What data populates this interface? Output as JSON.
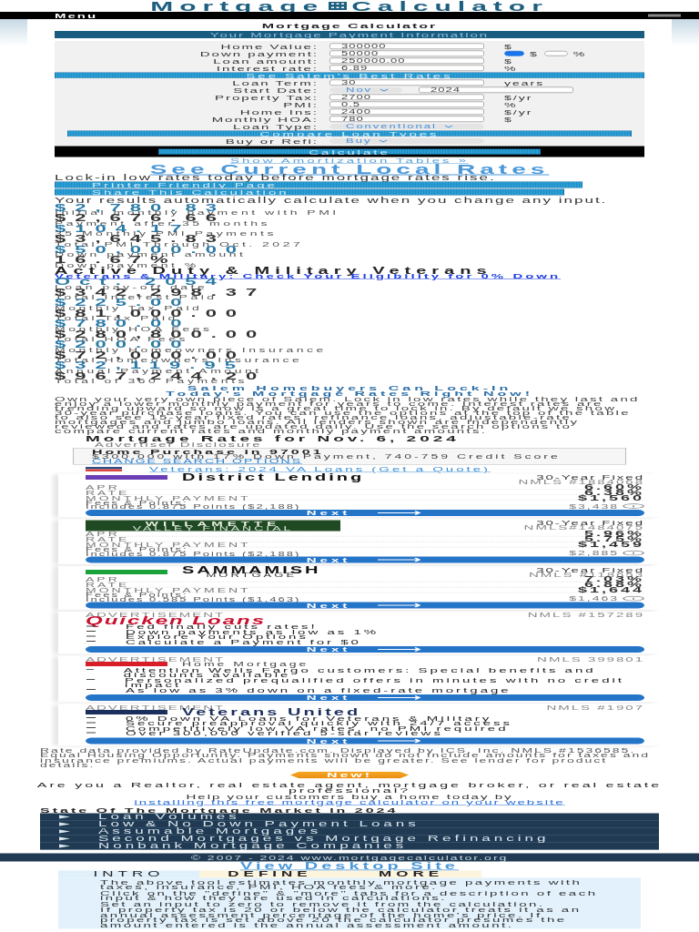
{
  "header": {
    "logo_left": "Mortgage",
    "logo_right": "Calculator",
    "menu": "Menu"
  },
  "calculator": {
    "title": "Mortgage Calculator",
    "subtitle": "Your Mortgage Payment Information",
    "rows": [
      {
        "kind": "input",
        "label": "Home Value:",
        "value": "300000",
        "unit": "$"
      },
      {
        "kind": "radio",
        "label": "Down payment:",
        "value": "50000",
        "options": [
          {
            "label": "$",
            "selected": true
          },
          {
            "label": "%",
            "selected": false
          }
        ]
      },
      {
        "kind": "input",
        "label": "Loan amount:",
        "value": "250000.00",
        "unit": "$"
      },
      {
        "kind": "input",
        "label": "Interest rate:",
        "value": "6.89",
        "unit": "%"
      },
      {
        "kind": "button",
        "label": "See Salem's Best Rates"
      },
      {
        "kind": "input",
        "label": "Loan Term:",
        "value": "30",
        "unit": "years"
      },
      {
        "kind": "date",
        "label": "Start Date:",
        "value": "Nov",
        "year": "2024"
      },
      {
        "kind": "input",
        "label": "Property Tax:",
        "value": "2700",
        "unit": "$/yr"
      },
      {
        "kind": "input",
        "label": "PMI:",
        "value": "0.5",
        "unit": "%"
      },
      {
        "kind": "input",
        "label": "Home Ins:",
        "value": "2400",
        "unit": "$/yr"
      },
      {
        "kind": "input",
        "label": "Monthly HOA:",
        "value": "780",
        "unit": "$"
      },
      {
        "kind": "select",
        "label": "Loan Type:",
        "value": "Conventional"
      },
      {
        "kind": "button",
        "label": "Compare Loan Types"
      },
      {
        "kind": "select",
        "label": "Buy or Refi:",
        "value": "Buy"
      }
    ],
    "calculate": "Calculate"
  },
  "amortization_link": "Show Amortization Tables »",
  "local_rates_link": "See Current Local Rates",
  "lock_text": "Lock-in low rates today before mortgage rates rise.",
  "action_buttons": [
    "Printer Friendly Page",
    "Share This Calculation"
  ],
  "results_note": "Your results automatically calculate when you change any input.",
  "results": [
    {
      "kind": "primary",
      "value": "$2,780.83",
      "label": "Initial monthly payment with PMI"
    },
    {
      "kind": "secondary",
      "value": "$2,676.66",
      "label": "Payment after 35 months"
    },
    {
      "kind": "primary",
      "value": "$104.17",
      "label": "35 Monthly PMI Payments"
    },
    {
      "kind": "secondary",
      "value": "$3,645.83",
      "label": "Total PMI Through Oct. 2027"
    },
    {
      "kind": "primary",
      "value": "$50,000.00",
      "label": "Down payment amount"
    },
    {
      "kind": "secondary",
      "value": "16.67%",
      "label": "Down payment %"
    },
    {
      "kind": "veterans",
      "value": "Active Duty & Military Veterans",
      "label": "Veterans & Military: Check Your Eligibility for 0% Down"
    },
    {
      "kind": "primary",
      "value": "Oct. 2054",
      "label": "Loan pay-off date"
    },
    {
      "kind": "secondary",
      "value": "$342,298.37",
      "label": "Total Interest Paid"
    },
    {
      "kind": "primary",
      "value": "$225.00",
      "label": "Monthly Tax Paid"
    },
    {
      "kind": "secondary",
      "value": "$81,000.00",
      "label": "Total Tax Paid"
    },
    {
      "kind": "primary",
      "value": "$780.00",
      "label": "Monthly HOA Fees"
    },
    {
      "kind": "secondary",
      "value": "$280,800.00",
      "label": "Total HOA Fees"
    },
    {
      "kind": "primary",
      "value": "$200.00",
      "label": "Monthly Homeowners Insurance"
    },
    {
      "kind": "secondary",
      "value": "$72,000.00",
      "label": "Total Homeowners Insurance"
    },
    {
      "kind": "primary",
      "value": "$32,119.95",
      "label": "Annual Payment Amount"
    },
    {
      "kind": "secondary",
      "value": "$967,244.20",
      "label": "Total of 360 Payments"
    }
  ],
  "promo": {
    "heading": "Salem Homebuyers Can Lock-In Today's Mortgage Rates Right Now!",
    "text": "Own your very own piece of Salem. Lock in low rates while they last and enjoy a lower monthly payment for years to come. Interest rates are trending upward so now is a great time to lock in. By default we show 30-year purchase loans. You can use the options at the top of the table to also see 15-year fixed rates, refinance loans, adjustable-rate mortgages and jumbo loans. All lenders shown are independently reviewed and rates are updated daily. Use the search options to compare current rates and monthly payment amounts."
  },
  "rates": {
    "title": "Mortgage Rates for Nov. 6, 2024",
    "disclosure": "Advertiser Disclosure",
    "search_title": "Home Purchase in 97001",
    "search_detail": "$300,000 with 17% Down Payment, 740-759 Credit Score",
    "search_link": "CHANGE SEARCH OPTIONS",
    "va_link": "Veterans: 2024 VA Loans (Get a Quote)",
    "offers": [
      {
        "kind": "rate",
        "logo": {
          "kind": "icon",
          "text": "District Lending",
          "color": "#6a3fb5"
        },
        "product": "30-Year Fixed",
        "nmls": "NMLS #1884068",
        "apr_label": "APR",
        "rate_label": "RATE",
        "payment_label": "MONTHLY PAYMENT",
        "apr": "6.60%",
        "rate": "6.38%",
        "payment": "$1,560",
        "fees_label": "Fees & Points:",
        "fees_detail": "Includes 0.875 Points ($2,188)",
        "fees": "$3,438",
        "button": "Next"
      },
      {
        "kind": "rate",
        "logo": {
          "kind": "block",
          "text": "WILLAMETTE",
          "sub": "VALLEY FINANCIAL",
          "color": "#1f4a24"
        },
        "product": "30-Year Fixed",
        "nmls": "NMLS#1484075",
        "apr_label": "APR",
        "rate_label": "RATE",
        "payment_label": "MONTHLY PAYMENT",
        "apr": "5.96%",
        "rate": "5.75%",
        "payment": "$1,459",
        "fees_label": "Fees & Points:",
        "fees_detail": "Includes 0.875 Points ($2,188)",
        "fees": "$2,885",
        "button": "Next"
      },
      {
        "kind": "rate",
        "logo": {
          "kind": "icon",
          "text": "SAMMAMISH",
          "sub": "MORTGAGE",
          "color": "#1aa33a"
        },
        "product": "30-Year Fixed",
        "nmls": "NMLS #118653",
        "apr_label": "APR",
        "rate_label": "RATE",
        "payment_label": "MONTHLY PAYMENT",
        "apr": "7.03%",
        "rate": "6.88%",
        "payment": "$1,644",
        "fees_label": "Fees & Points:",
        "fees_detail": "Includes 0.585 Points ($1,463)",
        "fees": "$1,463",
        "button": "Next"
      },
      {
        "kind": "ad",
        "tag": "ADVERTISEMENT",
        "logo": {
          "kind": "script",
          "text": "Quicken Loans",
          "color": "#c8102e"
        },
        "nmls": "NMLS #157289",
        "points": [
          "Fed finally cuts rates!",
          "Down payments as low as 1%",
          "Explore Your Options",
          "Calculate a Payment for $0"
        ],
        "button": "Next"
      },
      {
        "kind": "ad",
        "tag": "ADVERTISEMENT",
        "logo": {
          "kind": "plain",
          "text": "Home Mortgage",
          "color": "#d71e28"
        },
        "nmls": "NMLS 399801",
        "points": [
          "Attention Wells Fargo customers: Special benefits and discounts available",
          "Personalized prequalified offers in minutes with no credit impact",
          "As low as 3% down on a fixed-rate mortgage"
        ],
        "button": "Next"
      },
      {
        "kind": "ad",
        "tag": "ADVERTISEMENT",
        "logo": {
          "kind": "flag",
          "text": "Veterans United",
          "color": "#1b2f5c"
        },
        "nmls": "NMLS #1907",
        "points": [
          "0% Down VA Loans for Veterans & Military",
          "Secure preapproval quickly with 24/7 access",
          "Competitively low VA rates, no PMI required",
          "Over 300,000 verified 5-star reviews"
        ],
        "button": "Next"
      }
    ],
    "disclaimer": "Rate data provided by RateUpdate.com. Displayed by ICS, Inc. NMLS #1536585. Equal Housing Opportunity. Payments shown do not include amounts for taxes and insurance premiums. Actual payments will be greater. See lender for product details."
  },
  "new_badge": "New!",
  "realtor": {
    "question": "Are you a Realtor, real estate agent, mortgage broker, or real estate professional?",
    "text": "Help your customers buy a home today by",
    "link": "installing this free mortgage calculator on your website"
  },
  "market": {
    "title": "State Of The Mortgage Market In 2024",
    "items": [
      "Loan Volumes",
      "Low & No Down Payment Loans",
      "Assumable Mortgages",
      "Second Mortgages vs Mortgage Refinancing",
      "Nonbank Mortgage Companies"
    ]
  },
  "footer": {
    "copyright": "© 2007 - 2024 www.mortgagecalculator.org",
    "desktop_link": "View Desktop Site"
  },
  "info": {
    "tabs": [
      {
        "label": "INTRO",
        "selected": true
      },
      {
        "label": "DEFINE",
        "selected": false
      },
      {
        "label": "MORE",
        "selected": false
      }
    ],
    "paragraphs": [
      "The above tool estimates monthly mortgage payments with taxes, insurance, PMI, HOA fees & more.",
      "Click on the \"define\" & \"more\" tabs for a description of each input & how they are used in calculations.",
      "Set an input to zero to remove it from the calculation.",
      "If property tax is 20 or below the calculator treats it as an annual assessment percentage of the home's price. If property tax is set above 20 the calculator presumes the amount entered is the annual assessment amount."
    ]
  }
}
